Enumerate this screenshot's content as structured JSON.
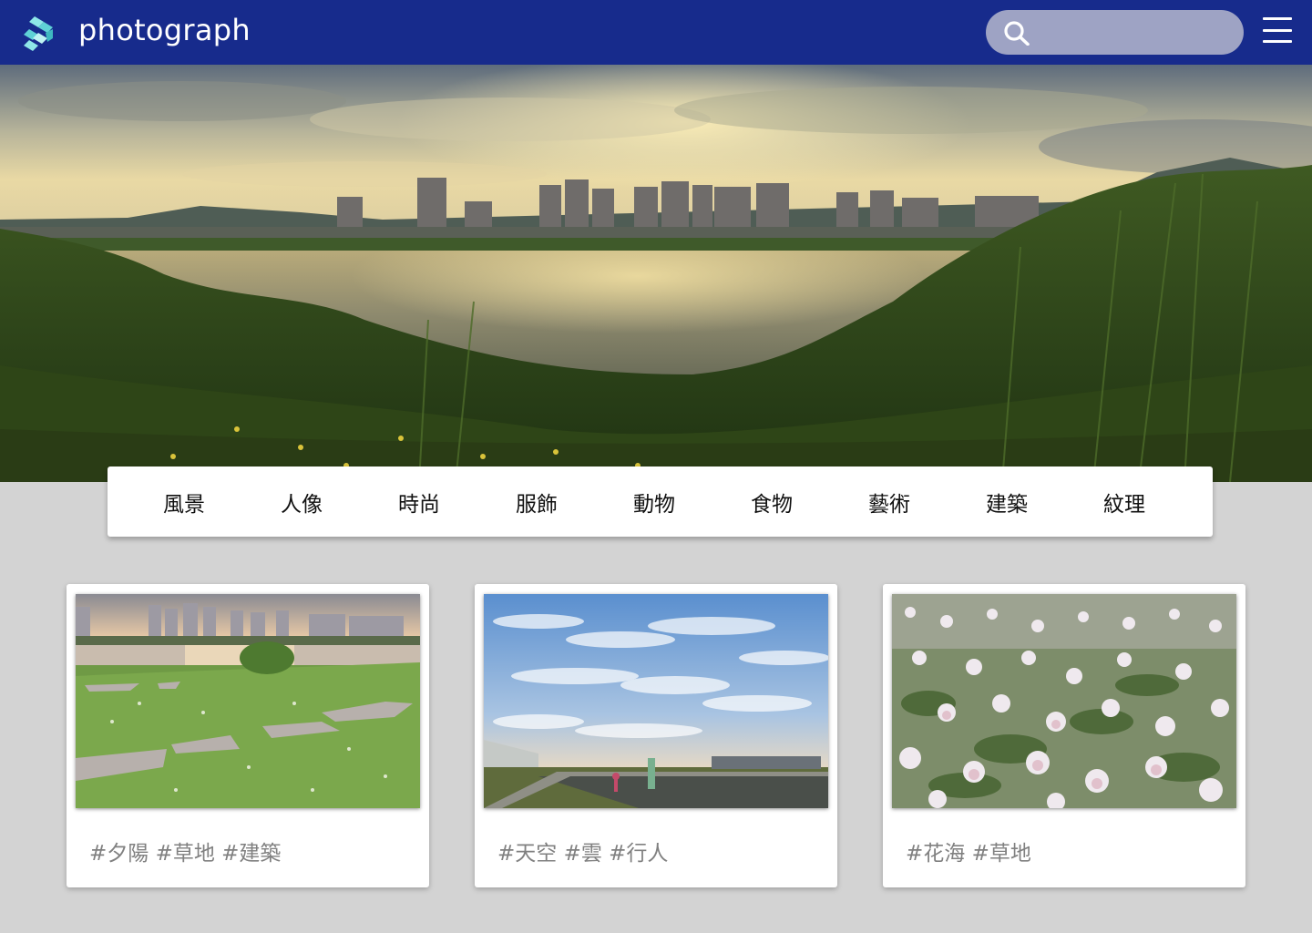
{
  "brand": {
    "name": "photograph"
  },
  "search": {
    "placeholder": ""
  },
  "categories": [
    {
      "label": "風景"
    },
    {
      "label": "人像"
    },
    {
      "label": "時尚"
    },
    {
      "label": "服飾"
    },
    {
      "label": "動物"
    },
    {
      "label": "食物"
    },
    {
      "label": "藝術"
    },
    {
      "label": "建築"
    },
    {
      "label": "紋理"
    }
  ],
  "cards": [
    {
      "tags": "#夕陽 #草地 #建築"
    },
    {
      "tags": "#天空 #雲 #行人"
    },
    {
      "tags": "#花海 #草地"
    }
  ],
  "colors": {
    "navbar": "#172b8c",
    "search_bg": "#9ea3c4",
    "page_bg": "#d3d3d3",
    "logo_accent": "#5fd1d6"
  },
  "icons": {
    "logo": "photograph-logo-icon",
    "search": "search-icon",
    "menu": "hamburger-menu-icon"
  }
}
